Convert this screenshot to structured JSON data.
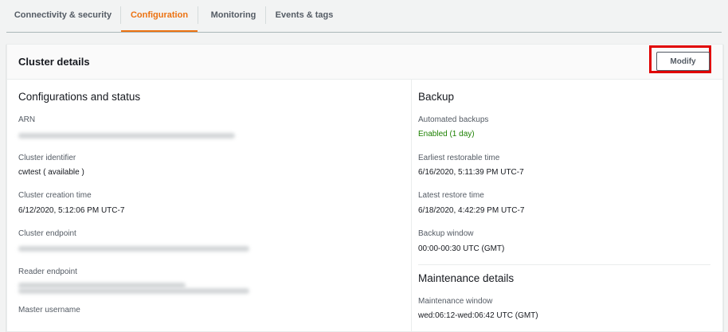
{
  "tabs": [
    {
      "label": "Connectivity & security"
    },
    {
      "label": "Configuration"
    },
    {
      "label": "Monitoring"
    },
    {
      "label": "Events & tags"
    }
  ],
  "panel": {
    "title": "Cluster details",
    "modify_label": "Modify"
  },
  "left": {
    "section_title": "Configurations and status",
    "fields": {
      "arn": {
        "label": "ARN"
      },
      "cluster_identifier": {
        "label": "Cluster identifier",
        "value": "cwtest ( available )"
      },
      "creation_time": {
        "label": "Cluster creation time",
        "value": "6/12/2020, 5:12:06 PM UTC-7"
      },
      "cluster_endpoint": {
        "label": "Cluster endpoint"
      },
      "reader_endpoint": {
        "label": "Reader endpoint"
      },
      "master_username": {
        "label": "Master username"
      }
    }
  },
  "right": {
    "backup_title": "Backup",
    "fields": {
      "automated_backups": {
        "label": "Automated backups",
        "value": "Enabled (1 day)"
      },
      "earliest_restore": {
        "label": "Earliest restorable time",
        "value": "6/16/2020, 5:11:39 PM UTC-7"
      },
      "latest_restore": {
        "label": "Latest restore time",
        "value": "6/18/2020, 4:42:29 PM UTC-7"
      },
      "backup_window": {
        "label": "Backup window",
        "value": "00:00-00:30 UTC (GMT)"
      }
    },
    "maintenance_title": "Maintenance details",
    "maintenance": {
      "label": "Maintenance window",
      "value": "wed:06:12-wed:06:42 UTC (GMT)"
    }
  },
  "colors": {
    "accent": "#ec7211",
    "success": "#1d8102",
    "highlight": "#e00000"
  }
}
